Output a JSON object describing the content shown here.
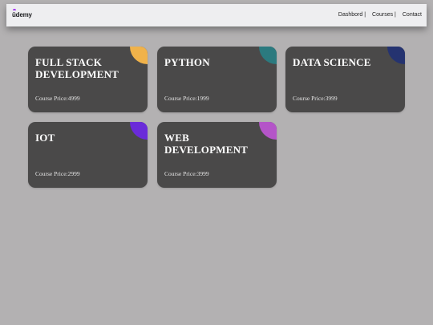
{
  "navbar": {
    "logo_text": "ûdemy",
    "links": [
      {
        "label": "Dashbord |"
      },
      {
        "label": "Courses |"
      },
      {
        "label": "Contact"
      }
    ]
  },
  "price_prefix": "Course Price:",
  "courses": [
    {
      "title": "FULL STACK DEVELOPMENT",
      "price_text": "Course Price:4999",
      "accent": "#f0b24a"
    },
    {
      "title": "PYTHON",
      "price_text": "Course Price:1999",
      "accent": "#2b7a7f"
    },
    {
      "title": "DATA SCIENCE",
      "price_text": "Course Price:3999",
      "accent": "#253370"
    },
    {
      "title": "IOT",
      "price_text": "Course Price:2999",
      "accent": "#6a2bd9"
    },
    {
      "title": "WEB DEVELOPMENT",
      "price_text": "Course Price:3999",
      "accent": "#b455c8"
    }
  ],
  "colors": {
    "page_bg": "#b3b1b2",
    "navbar_bg": "#eeeef0",
    "card_bg": "#4a4949",
    "logo_accent": "#a435f0"
  }
}
